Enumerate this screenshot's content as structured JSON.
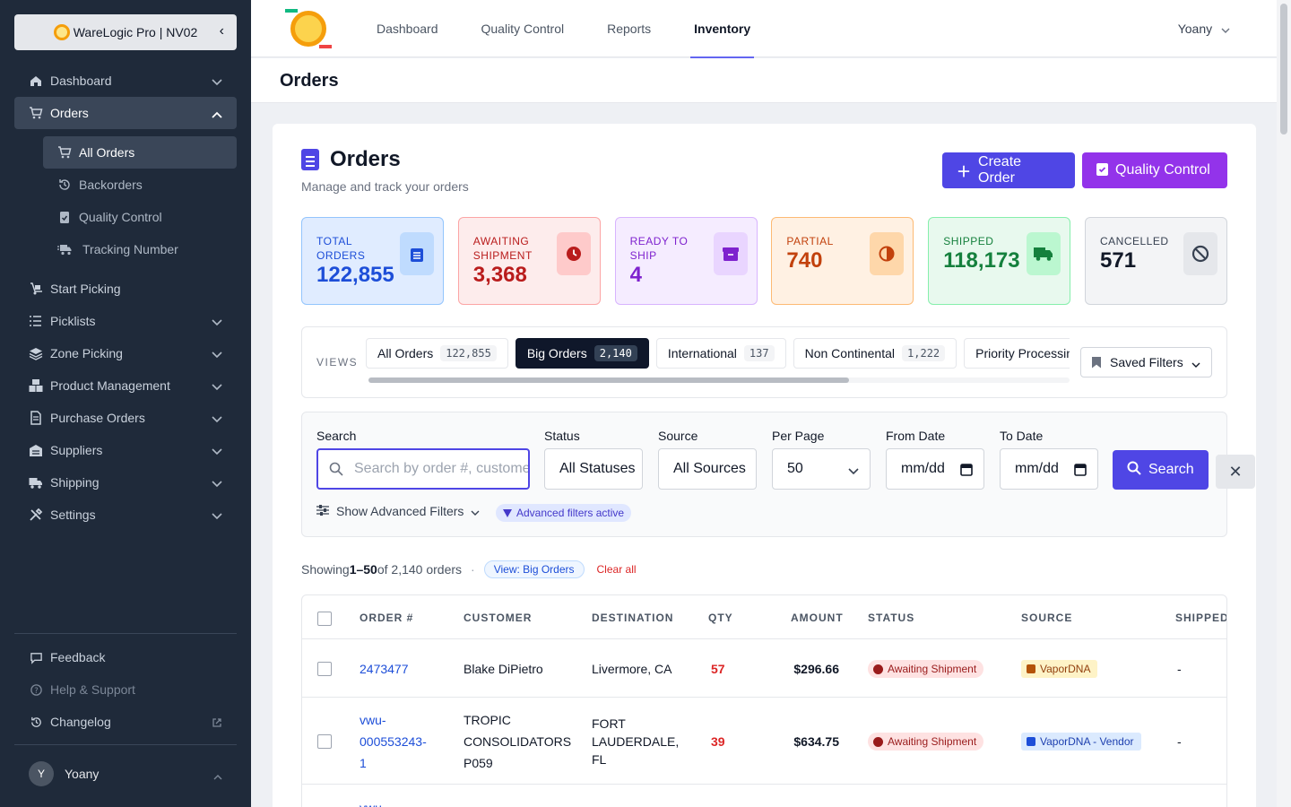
{
  "sidebar": {
    "brand": "WareLogic Pro | NV02",
    "items": [
      {
        "label": "Dashboard",
        "icon": "home-icon",
        "expand": true
      },
      {
        "label": "Orders",
        "icon": "cart-icon",
        "expand": true,
        "active": true
      },
      {
        "label": "Start Picking",
        "icon": "dolly-icon"
      },
      {
        "label": "Picklists",
        "icon": "list-icon",
        "expand": true
      },
      {
        "label": "Zone Picking",
        "icon": "layers-icon",
        "expand": true
      },
      {
        "label": "Product Management",
        "icon": "boxes-icon",
        "expand": true
      },
      {
        "label": "Purchase Orders",
        "icon": "document-icon",
        "expand": true
      },
      {
        "label": "Suppliers",
        "icon": "warehouse-icon",
        "expand": true
      },
      {
        "label": "Shipping",
        "icon": "truck-icon",
        "expand": true
      },
      {
        "label": "Settings",
        "icon": "tools-icon",
        "expand": true
      }
    ],
    "orders_sub": [
      {
        "label": "All Orders",
        "icon": "cart-icon",
        "active": true
      },
      {
        "label": "Backorders",
        "icon": "history-icon"
      },
      {
        "label": "Quality Control",
        "icon": "clipboard-check-icon"
      },
      {
        "label": "Tracking Number",
        "icon": "truck-fast-icon"
      }
    ],
    "bottom": {
      "feedback": "Feedback",
      "help": "Help & Support",
      "changelog": "Changelog"
    },
    "user": {
      "initial": "Y",
      "name": "Yoany"
    }
  },
  "topbar": {
    "tabs": [
      "Dashboard",
      "Quality Control",
      "Reports",
      "Inventory"
    ],
    "active_tab": "Inventory",
    "user": "Yoany"
  },
  "page_title": "Orders",
  "header": {
    "title": "Orders",
    "subtitle": "Manage and track your orders",
    "create_label": "Create Order",
    "qc_label": "Quality Control"
  },
  "stats": [
    {
      "label": "TOTAL ORDERS",
      "value": "122,855",
      "icon": "clipboard-list-icon",
      "bg": "#e0ecff",
      "border": "#93c5fd",
      "color": "#1d4ed8",
      "icon_bg": "#bfdbfe"
    },
    {
      "label": "AWAITING SHIPMENT",
      "value": "3,368",
      "icon": "clock-icon",
      "bg": "#fdecec",
      "border": "#fca5a5",
      "color": "#b91c1c",
      "icon_bg": "#fecaca"
    },
    {
      "label": "READY TO SHIP",
      "value": "4",
      "icon": "box-icon",
      "bg": "#f5ecff",
      "border": "#d8b4fe",
      "color": "#7e22ce",
      "icon_bg": "#e9d5ff"
    },
    {
      "label": "PARTIAL",
      "value": "740",
      "icon": "half-circle-icon",
      "bg": "#fff1e3",
      "border": "#fdba74",
      "color": "#c2410c",
      "icon_bg": "#fed7aa"
    },
    {
      "label": "SHIPPED",
      "value": "118,173",
      "icon": "truck-icon",
      "bg": "#e8f9ee",
      "border": "#86efac",
      "color": "#15803d",
      "icon_bg": "#bbf7d0"
    },
    {
      "label": "CANCELLED",
      "value": "571",
      "icon": "ban-icon",
      "bg": "#f3f4f6",
      "border": "#d1d5db",
      "color": "#374151",
      "icon_bg": "#e5e7eb"
    }
  ],
  "views": {
    "label": "VIEWS",
    "tabs": [
      {
        "label": "All Orders",
        "count": "122,855"
      },
      {
        "label": "Big Orders",
        "count": "2,140",
        "active": true
      },
      {
        "label": "International",
        "count": "137"
      },
      {
        "label": "Non Continental",
        "count": "1,222"
      },
      {
        "label": "Priority Processing",
        "count": ""
      }
    ],
    "saved_filters": "Saved Filters"
  },
  "filters": {
    "search_label": "Search",
    "search_placeholder": "Search by order #, customer",
    "status_label": "Status",
    "status_value": "All Statuses",
    "source_label": "Source",
    "source_value": "All Sources",
    "perpage_label": "Per Page",
    "perpage_value": "50",
    "from_label": "From Date",
    "from_value": "mm/dd",
    "to_label": "To Date",
    "to_value": "mm/dd",
    "search_button": "Search",
    "advanced": "Show Advanced Filters",
    "advanced_active": "Advanced filters active"
  },
  "results": {
    "showing_prefix": "Showing ",
    "range": "1–50",
    "suffix": " of 2,140 orders",
    "view_pill": "View: Big Orders",
    "clear_all": "Clear all"
  },
  "table": {
    "columns": [
      "ORDER #",
      "CUSTOMER",
      "DESTINATION",
      "QTY",
      "AMOUNT",
      "STATUS",
      "SOURCE",
      "SHIPPED"
    ],
    "rows": [
      {
        "order": [
          "2473477"
        ],
        "customer": [
          "Blake DiPietro"
        ],
        "destination": [
          "Livermore, CA"
        ],
        "qty": "57",
        "amount": "$296.66",
        "status": "Awaiting Shipment",
        "source": "VaporDNA",
        "source_style": "y",
        "shipped": "-"
      },
      {
        "order": [
          "vwu-",
          "000553243-",
          "1"
        ],
        "customer": [
          "TROPIC",
          "CONSOLIDATORS",
          "P059"
        ],
        "destination": [
          "FORT",
          "LAUDERDALE,",
          "FL"
        ],
        "qty": "39",
        "amount": "$634.75",
        "status": "Awaiting Shipment",
        "source": "VaporDNA - Vendor",
        "source_style": "b",
        "shipped": "-"
      },
      {
        "order": [
          "vwu-"
        ],
        "customer": [
          ""
        ],
        "destination": [
          ""
        ],
        "qty": "",
        "amount": "",
        "status": "",
        "source": "",
        "source_style": "",
        "shipped": ""
      }
    ]
  }
}
